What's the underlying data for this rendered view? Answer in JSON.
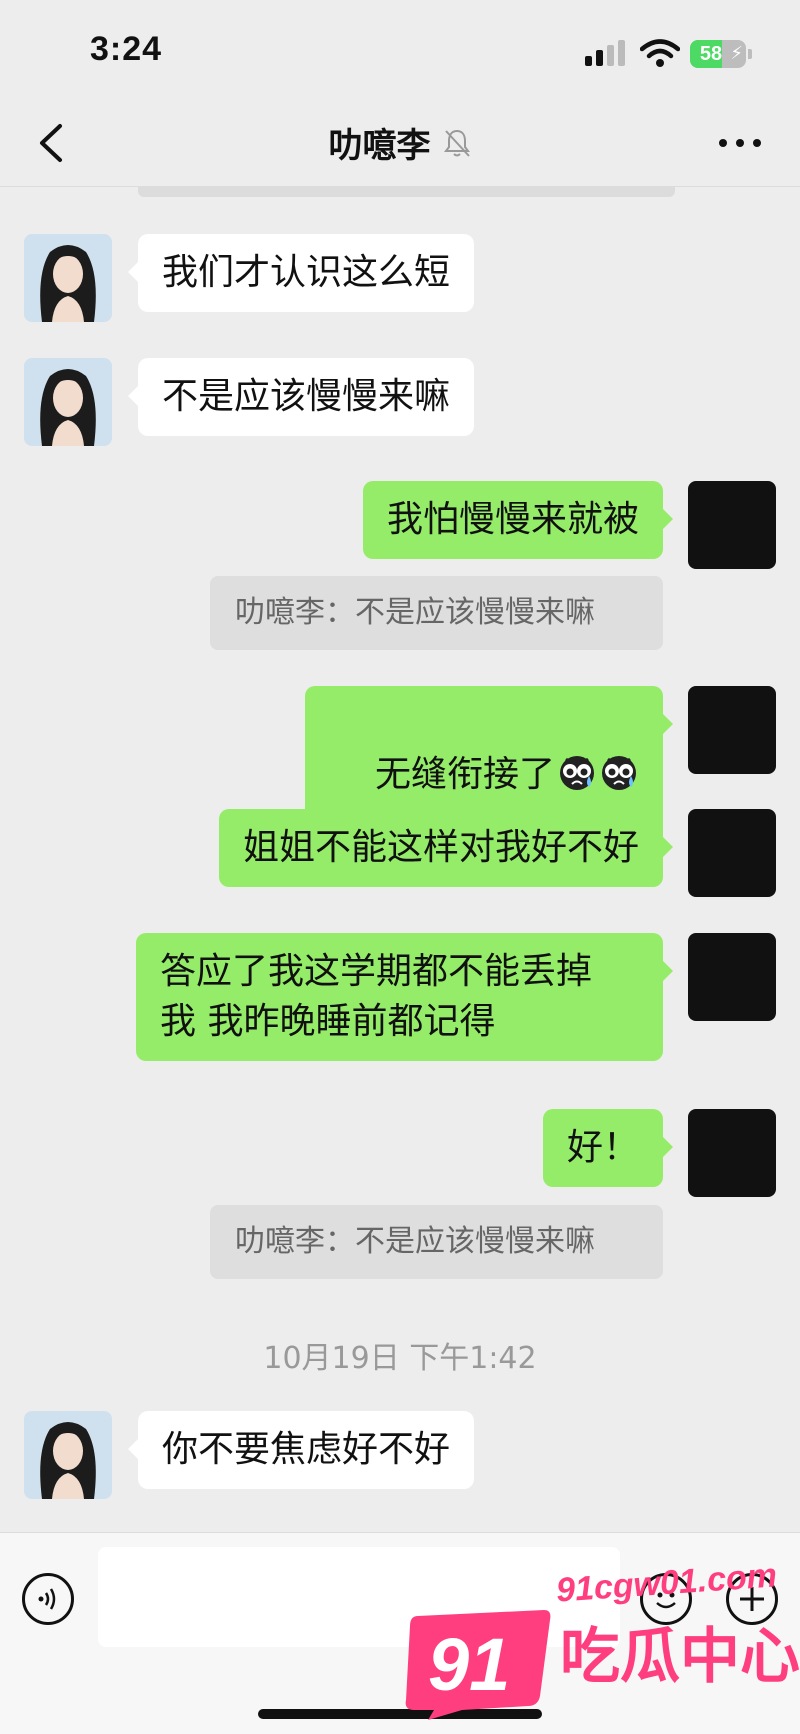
{
  "status_bar": {
    "time": "3:24",
    "battery": 58,
    "battery_label": "58",
    "battery_icon": "battery-charging-icon",
    "signal_icon": "cellular-signal-icon",
    "wifi_icon": "wifi-icon"
  },
  "nav": {
    "title": "叻噫李",
    "back_icon": "chevron-left-icon",
    "mute_icon": "bell-muted-icon",
    "more_icon": "more-dots-icon"
  },
  "messages": [
    {
      "from": "her",
      "text": "我们才认识这么短"
    },
    {
      "from": "her",
      "text": "不是应该慢慢来嘛"
    },
    {
      "from": "me",
      "text": "我怕慢慢来就被"
    },
    {
      "from": "quote",
      "text": "叻噫李：不是应该慢慢来嘛"
    },
    {
      "from": "me",
      "text": "无缝衔接了",
      "emoji": "crying-face-emoji ×2"
    },
    {
      "from": "me",
      "text": "姐姐不能这样对我好不好"
    },
    {
      "from": "me",
      "text": "答应了我这学期都不能丢掉\n我 我昨晚睡前都记得"
    },
    {
      "from": "me",
      "text": "好！"
    },
    {
      "from": "quote",
      "text": "叻噫李：不是应该慢慢来嘛"
    },
    {
      "from": "time",
      "text": "10月19日 下午1:42"
    },
    {
      "from": "her",
      "text": "你不要焦虑好不好"
    }
  ],
  "input_bar": {
    "voice_icon": "voice-input-icon",
    "input_value": "",
    "emoji_icon": "emoji-icon",
    "plus_icon": "plus-circle-icon"
  },
  "watermark": {
    "badge": "91",
    "url": "91cgw01.com",
    "name": "吃瓜中心"
  },
  "colors": {
    "background": "#ededed",
    "incoming_bubble": "#ffffff",
    "outgoing_bubble": "#95ec69",
    "watermark": "#ff3e7f"
  }
}
